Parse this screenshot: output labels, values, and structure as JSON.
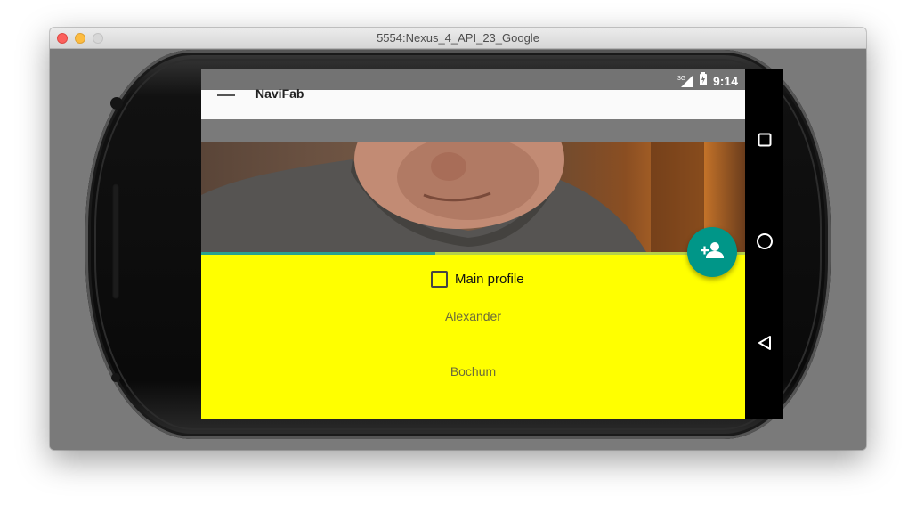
{
  "window": {
    "title": "5554:Nexus_4_API_23_Google"
  },
  "status_bar": {
    "network": "3G",
    "time": "9:14"
  },
  "toolbar": {
    "title": "NaviFab"
  },
  "header": {
    "progress_fraction": 0.43
  },
  "fab": {
    "icon": "person-add-icon",
    "color": "#009688"
  },
  "form": {
    "checkbox_label": "Main profile",
    "checked": false,
    "first_name": "Alexander",
    "city": "Bochum",
    "background": "#ffff00"
  },
  "nav_bar": {
    "icons": [
      "recent-apps-icon",
      "home-icon",
      "back-icon"
    ]
  }
}
